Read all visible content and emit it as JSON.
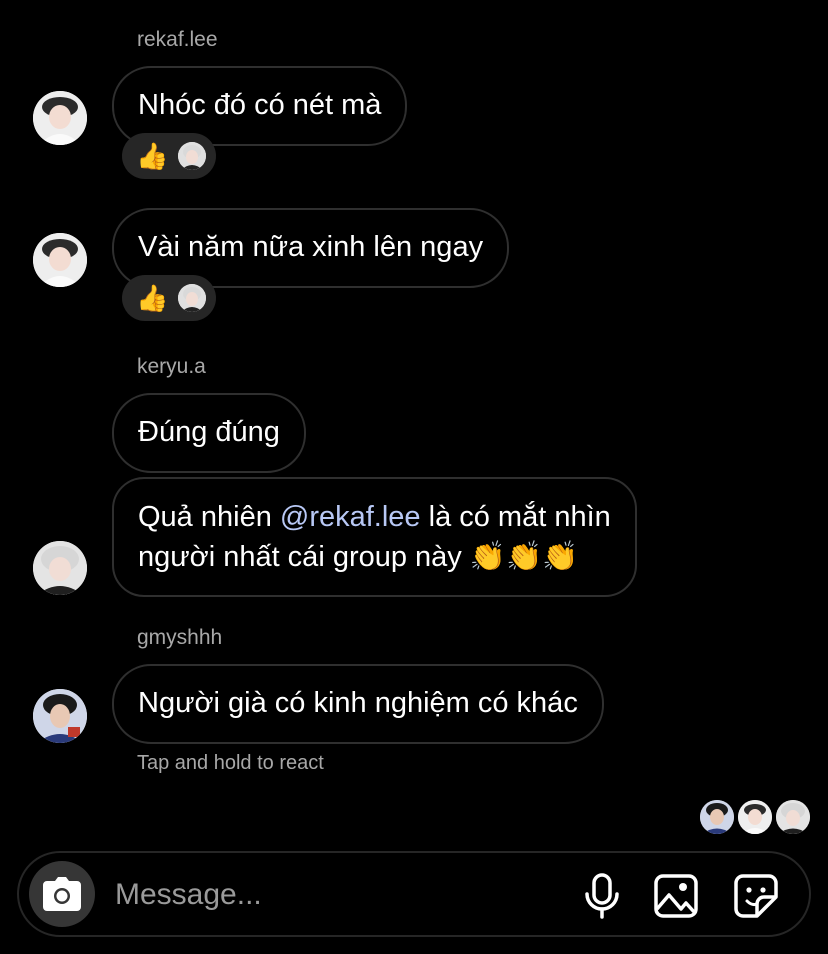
{
  "messages": {
    "group1_sender": "rekaf.lee",
    "msg1": "Nhóc đó có nét mà",
    "msg2": "Vài năm nữa xinh lên ngay",
    "group2_sender": "keryu.a",
    "msg3": "Đúng đúng",
    "msg4_prefix": "Quả nhiên ",
    "msg4_mention": "@rekaf.lee",
    "msg4_suffix": " là có mắt nhìn",
    "msg4_line2": "người nhất cái group này 👏👏👏",
    "group3_sender": "gmyshhh",
    "msg5": "Người già có kinh nghiệm có khác"
  },
  "reactions": {
    "r1_emoji": "👍",
    "r2_emoji": "👍"
  },
  "hint": "Tap and hold to react",
  "composer": {
    "placeholder": "Message..."
  },
  "icons": {
    "camera": "camera-icon",
    "mic": "microphone-icon",
    "gallery": "gallery-icon",
    "sticker": "sticker-icon"
  },
  "colors": {
    "background": "#000000",
    "bubble_border": "#2f2f2f",
    "mention": "#b8c8f5",
    "reaction_bg": "#262626",
    "secondary_text": "#a8a8a8"
  }
}
